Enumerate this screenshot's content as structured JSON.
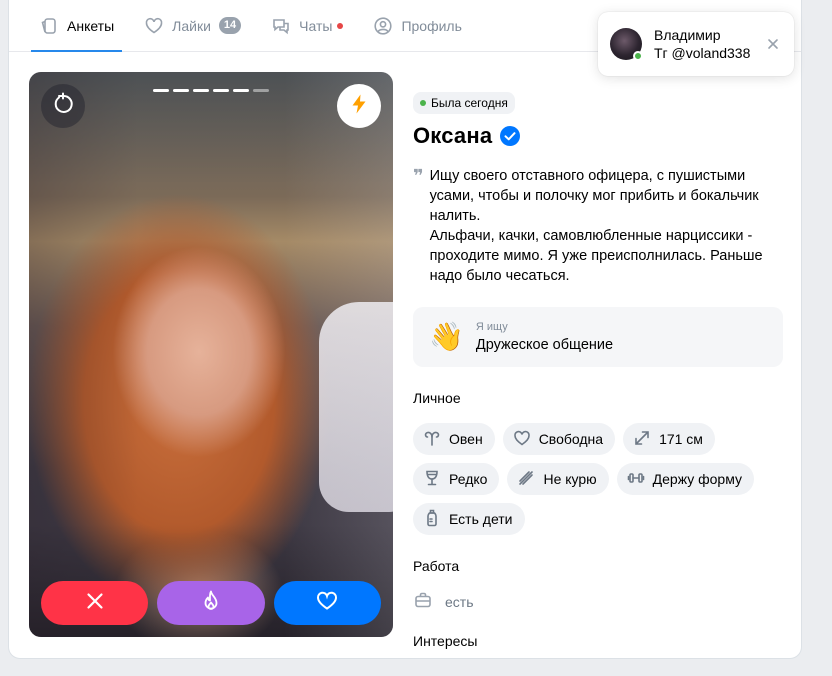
{
  "tabs": [
    {
      "label": "Анкеты",
      "active": true,
      "icon": "cards-icon"
    },
    {
      "label": "Лайки",
      "badge": "14",
      "icon": "heart-icon"
    },
    {
      "label": "Чаты",
      "dot": true,
      "icon": "chat-icon"
    },
    {
      "label": "Профиль",
      "icon": "user-circle-icon"
    }
  ],
  "notification": {
    "name": "Владимир",
    "message": "Тг @voland338"
  },
  "profile": {
    "status": "Была сегодня",
    "name": "Оксана",
    "verified": true,
    "bio_lines": [
      "Ищу своего отставного офицера, с пушистыми усами, чтобы и полочку мог прибить и бокальчик налить.",
      "Альфачи, качки, самовлюбленные нарциссики - проходите мимо. Я уже преисполнилась. Раньше надо было чесаться."
    ],
    "looking_for": {
      "label": "Я ищу",
      "value": "Дружеское общение",
      "icon": "waving-hand-emoji"
    },
    "personal_title": "Личное",
    "personal_tags": [
      {
        "label": "Овен",
        "icon": "aries-icon"
      },
      {
        "label": "Свободна",
        "icon": "heart-outline-icon"
      },
      {
        "label": "171 см",
        "icon": "height-icon"
      },
      {
        "label": "Редко",
        "icon": "wine-glass-icon"
      },
      {
        "label": "Не курю",
        "icon": "no-smoking-icon"
      },
      {
        "label": "Держу форму",
        "icon": "dumbbell-icon"
      },
      {
        "label": "Есть дети",
        "icon": "baby-bottle-icon"
      }
    ],
    "work_title": "Работа",
    "work_value": "есть",
    "interests_title": "Интересы"
  },
  "photo": {
    "segments_total": 6,
    "segments_active": 5
  },
  "colors": {
    "accent": "#2688eb",
    "dislike": "#ff3347",
    "superlike": "#a864e8",
    "like": "#0077ff",
    "online": "#4bb34b"
  }
}
